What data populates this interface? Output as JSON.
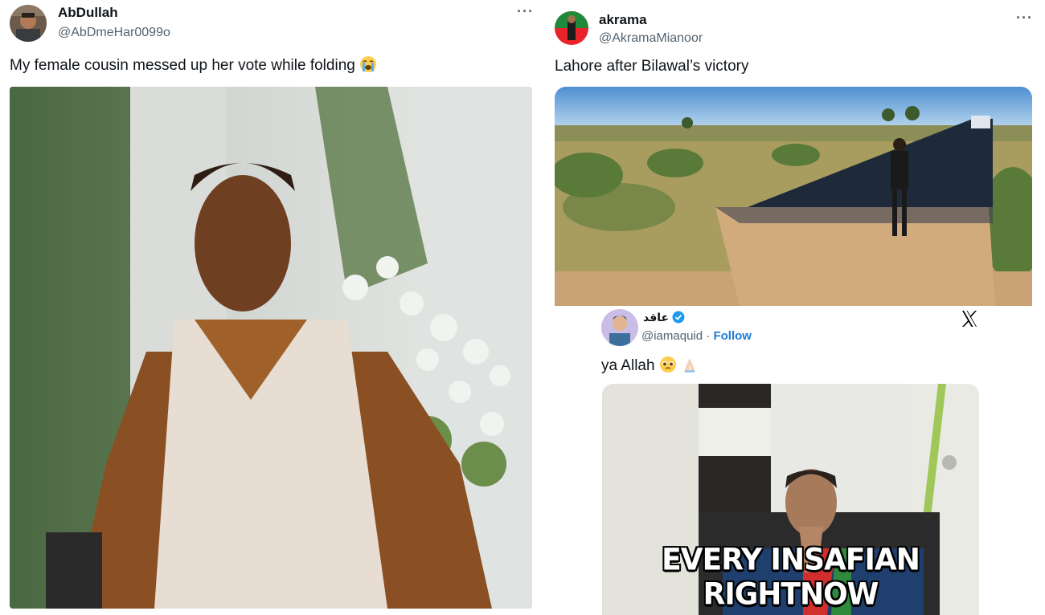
{
  "left_tweet": {
    "author_name": "AbDullah",
    "author_handle": "@AbDmeHar0099o",
    "more_label": "···",
    "text": "My female cousin messed up her vote while folding",
    "emoji": "loudly-crying-face-emoji"
  },
  "right_tweet": {
    "author_name": "akrama",
    "author_handle": "@AkramaMianoor",
    "more_label": "···",
    "text": "Lahore after Bilawal’s victory",
    "embed": {
      "author_name": "عاقد",
      "author_handle": "@iamaquid",
      "separator": " · ",
      "follow_label": "Follow",
      "text": "ya Allah",
      "emojis": [
        "pleading-face-emoji",
        "folded-hands-emoji"
      ],
      "image_caption": "EVERY INSAFIAN RIGHTNOW",
      "verified_color": "#1d9bf0"
    }
  },
  "colors": {
    "text_primary": "#0f1419",
    "text_secondary": "#536471",
    "link": "#1d7bd6"
  }
}
